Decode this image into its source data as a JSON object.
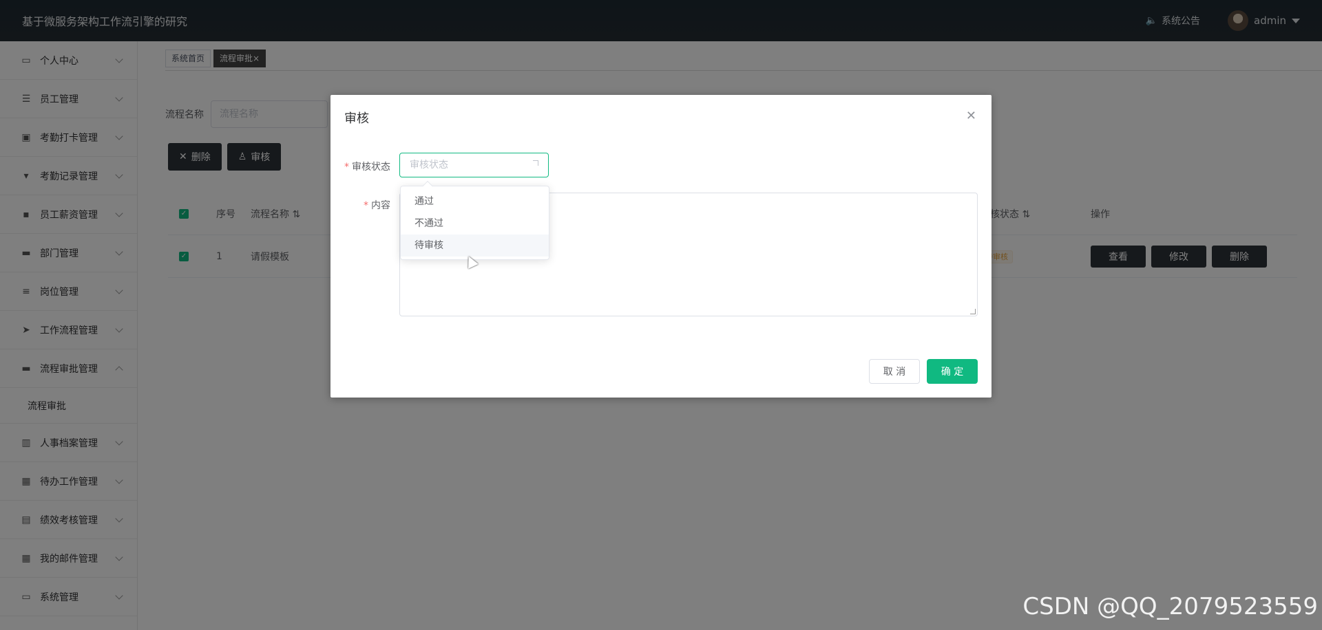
{
  "header": {
    "title": "基于微服务架构工作流引擎的研究",
    "notice": "系统公告",
    "user": "admin"
  },
  "sidebar": {
    "items": [
      {
        "label": "个人中心",
        "icon": "user-card-icon"
      },
      {
        "label": "员工管理",
        "icon": "sliders-icon"
      },
      {
        "label": "考勤打卡管理",
        "icon": "clipboard-check-icon"
      },
      {
        "label": "考勤记录管理",
        "icon": "stamp-icon"
      },
      {
        "label": "员工薪资管理",
        "icon": "chat-icon"
      },
      {
        "label": "部门管理",
        "icon": "briefcase-icon"
      },
      {
        "label": "岗位管理",
        "icon": "list-icon"
      },
      {
        "label": "工作流程管理",
        "icon": "send-icon"
      },
      {
        "label": "流程审批管理",
        "icon": "briefcase-icon",
        "open": true
      },
      {
        "label": "人事档案管理",
        "icon": "books-icon"
      },
      {
        "label": "待办工作管理",
        "icon": "grid-icon"
      },
      {
        "label": "绩效考核管理",
        "icon": "clipboard-icon"
      },
      {
        "label": "我的邮件管理",
        "icon": "grid-icon"
      },
      {
        "label": "系统管理",
        "icon": "monitor-icon"
      }
    ],
    "sub_item": "流程审批"
  },
  "tags": {
    "home": "系统首页",
    "current": "流程审批",
    "close": "×"
  },
  "search": {
    "label": "流程名称",
    "placeholder": "流程名称"
  },
  "toolbar": {
    "delete": "删除",
    "review": "审核"
  },
  "table": {
    "headers": [
      "序号",
      "流程名称",
      "审核状态",
      "操作"
    ],
    "row": {
      "index": "1",
      "name": "请假模板",
      "status": "待审核"
    },
    "ops": [
      "查看",
      "修改",
      "删除"
    ]
  },
  "dialog": {
    "title": "审核",
    "status_label": "审核状态",
    "status_placeholder": "审核状态",
    "content_label": "内容",
    "cancel": "取 消",
    "confirm": "确 定",
    "options": [
      "通过",
      "不通过",
      "待审核"
    ]
  },
  "watermark": "CSDN @QQ_2079523559",
  "colors": {
    "accent": "#10b981",
    "header_bg": "#1f2937",
    "dark_button": "#2d3238"
  }
}
